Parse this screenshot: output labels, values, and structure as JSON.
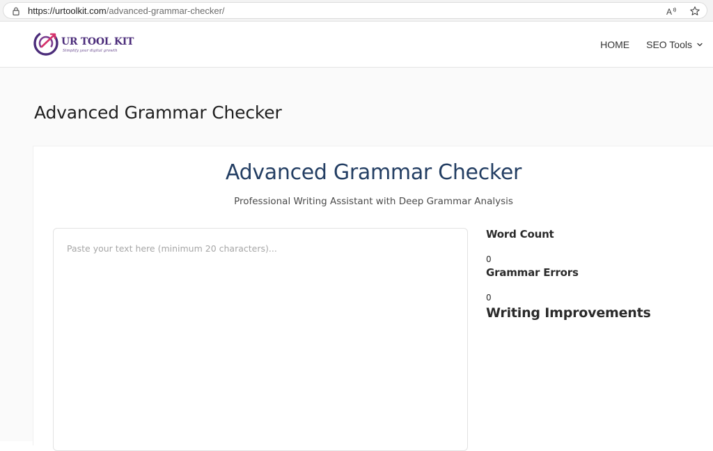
{
  "browser": {
    "url_host": "https://urtoolkit.com",
    "url_path": "/advanced-grammar-checker/"
  },
  "header": {
    "logo_word": "UR TOOL KIT",
    "logo_tagline": "Simplify your digital growth",
    "nav": [
      {
        "label": "HOME"
      },
      {
        "label": "SEO Tools"
      }
    ]
  },
  "page": {
    "title": "Advanced Grammar Checker"
  },
  "tool": {
    "title": "Advanced Grammar Checker",
    "subtitle": "Professional Writing Assistant with Deep Grammar Analysis",
    "input": {
      "value": "",
      "placeholder": "Paste your text here (minimum 20 characters)..."
    },
    "stats": {
      "word_count_label": "Word Count",
      "word_count_value": "0",
      "grammar_errors_label": "Grammar Errors",
      "grammar_errors_value": "0",
      "improvements_label": "Writing Improvements"
    }
  },
  "colors": {
    "tool_title": "#233e63",
    "logo_purple": "#4b2c7a"
  }
}
